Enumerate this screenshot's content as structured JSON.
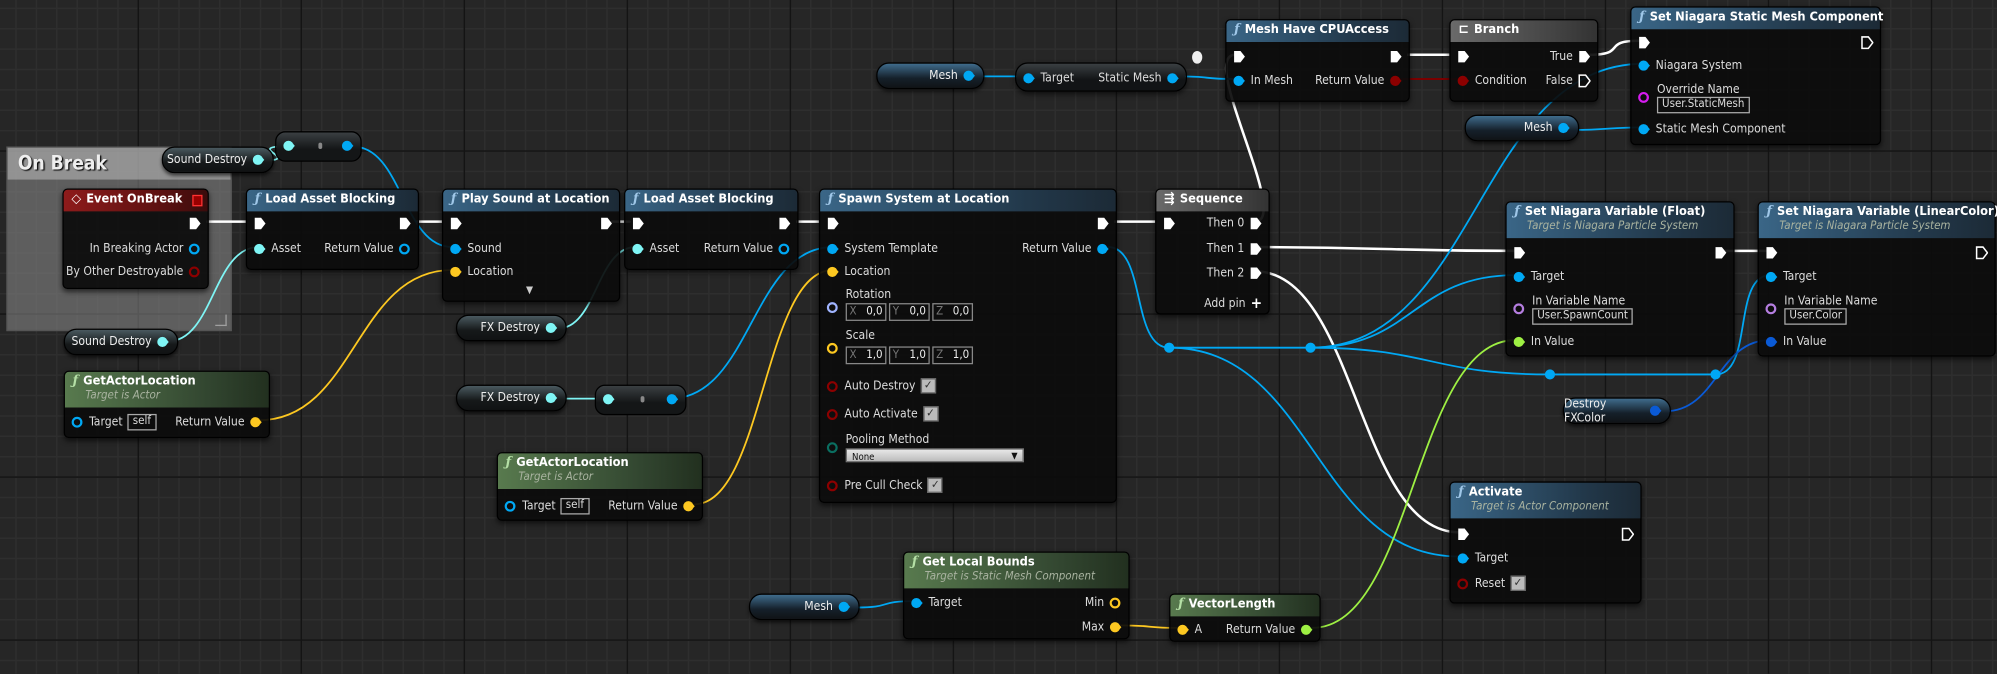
{
  "graph": {
    "comment": "On Break",
    "variables": {
      "sound_destroy": "Sound Destroy",
      "fx_destroy": "FX Destroy",
      "mesh": "Mesh",
      "destroy_fx_color": "Destroy FXColor"
    },
    "nodes": {
      "event_onbreak": {
        "title": "Event OnBreak",
        "pins": [
          "In Breaking Actor",
          "By Other Destroyable"
        ]
      },
      "load_asset_1": {
        "title": "Load Asset Blocking",
        "pins": [
          "Asset",
          "Return Value"
        ]
      },
      "play_sound": {
        "title": "Play Sound at Location",
        "pins": [
          "Sound",
          "Location"
        ]
      },
      "load_asset_2": {
        "title": "Load Asset Blocking",
        "pins": [
          "Asset",
          "Return Value"
        ]
      },
      "spawn_system": {
        "title": "Spawn System at Location",
        "pins": [
          "System Template",
          "Location",
          "Rotation",
          "Scale",
          "Auto Destroy",
          "Auto Activate",
          "Pooling Method",
          "Pre Cull Check",
          "Return Value"
        ],
        "rotation": {
          "x": "0,0",
          "y": "0,0",
          "z": "0,0"
        },
        "scale": {
          "x": "1,0",
          "y": "1,0",
          "z": "1,0"
        },
        "auto_destroy": true,
        "auto_activate": true,
        "pooling_method": "None",
        "pre_cull_check": true
      },
      "sequence": {
        "title": "Sequence",
        "pins": [
          "Then 0",
          "Then 1",
          "Then 2"
        ],
        "add_pin": "Add pin"
      },
      "get_actor_location_1": {
        "title": "GetActorLocation",
        "subtitle": "Target is Actor",
        "pins": [
          "Target",
          "Return Value"
        ],
        "target_value": "self"
      },
      "get_actor_location_2": {
        "title": "GetActorLocation",
        "subtitle": "Target is Actor",
        "pins": [
          "Target",
          "Return Value"
        ],
        "target_value": "self"
      },
      "get_static_mesh": {
        "pins": [
          "Target",
          "Static Mesh"
        ]
      },
      "mesh_have_cpu_access": {
        "title": "Mesh Have CPUAccess",
        "pins": [
          "In Mesh",
          "Return Value"
        ]
      },
      "branch": {
        "title": "Branch",
        "pins": [
          "True",
          "Condition",
          "False"
        ]
      },
      "set_static_mesh": {
        "title": "Set Niagara Static Mesh Component",
        "pins": [
          "Niagara System",
          "Override Name",
          "Static Mesh Component"
        ],
        "override_name": "User.StaticMesh"
      },
      "set_float": {
        "title": "Set Niagara Variable (Float)",
        "subtitle": "Target is Niagara Particle System",
        "pins": [
          "Target",
          "In Variable Name",
          "In Value"
        ],
        "variable_name": "User.SpawnCount"
      },
      "set_color": {
        "title": "Set Niagara Variable (LinearColor)",
        "subtitle": "Target is Niagara Particle System",
        "pins": [
          "Target",
          "In Variable Name",
          "In Value"
        ],
        "variable_name": "User.Color"
      },
      "activate": {
        "title": "Activate",
        "subtitle": "Target is Actor Component",
        "pins": [
          "Target",
          "Reset"
        ],
        "reset": true
      },
      "get_local_bounds": {
        "title": "Get Local Bounds",
        "subtitle": "Target is Static Mesh Component",
        "pins": [
          "Target",
          "Min",
          "Max"
        ]
      },
      "vector_length": {
        "title": "VectorLength",
        "pins": [
          "A",
          "Return Value"
        ]
      }
    }
  },
  "colors": {
    "exec": "#ffffff",
    "object": "#00a8f4",
    "soft_object": "#7ff5f5",
    "vector": "#fdc821",
    "rotator": "#a0b4ff",
    "bool": "#8c0000",
    "name": "#d61cf0",
    "float": "#9ef043",
    "linear_color": "#0a5ad6",
    "enum": "#0a6e60"
  }
}
